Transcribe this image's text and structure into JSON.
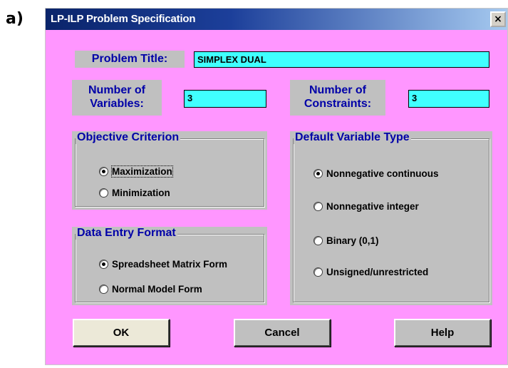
{
  "figure_label": "a)",
  "window": {
    "title": "LP-ILP Problem Specification",
    "close_glyph": "×"
  },
  "problem_title": {
    "label": "Problem Title:",
    "value": "SIMPLEX DUAL"
  },
  "num_variables": {
    "label_line1": "Number of",
    "label_line2": "Variables:",
    "value": "3"
  },
  "num_constraints": {
    "label_line1": "Number of",
    "label_line2": "Constraints:",
    "value": "3"
  },
  "objective_criterion": {
    "title": "Objective Criterion",
    "options": [
      {
        "label": "Maximization",
        "checked": true
      },
      {
        "label": "Minimization",
        "checked": false
      }
    ]
  },
  "data_entry_format": {
    "title": "Data Entry Format",
    "options": [
      {
        "label": "Spreadsheet Matrix Form",
        "checked": true
      },
      {
        "label": "Normal Model Form",
        "checked": false
      }
    ]
  },
  "default_variable_type": {
    "title": "Default Variable Type",
    "options": [
      {
        "label": "Nonnegative continuous",
        "checked": true
      },
      {
        "label": "Nonnegative integer",
        "checked": false
      },
      {
        "label": "Binary (0,1)",
        "checked": false
      },
      {
        "label": "Unsigned/unrestricted",
        "checked": false
      }
    ]
  },
  "buttons": {
    "ok": "OK",
    "cancel": "Cancel",
    "help": "Help"
  },
  "colors": {
    "dialog_background": "#ff96ff",
    "title_bar": "#0a246a",
    "field_background": "#40ffff",
    "label_text": "#0000a8",
    "panel": "#c0c0c0"
  }
}
